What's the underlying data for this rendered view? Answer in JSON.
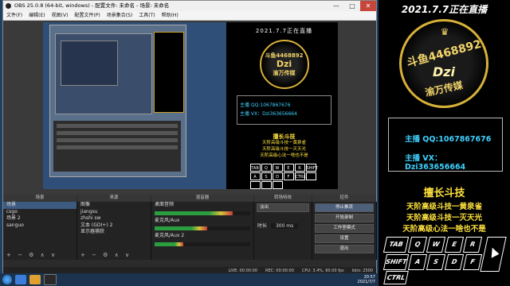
{
  "window": {
    "title": "OBS 25.0.8 (64-bit, windows) - 配置文件: 未命名 - 场景: 未命名",
    "buttons": {
      "minimize": "—",
      "maximize": "□",
      "close": "✕"
    },
    "menu": [
      "文件(F)",
      "编辑(E)",
      "视图(V)",
      "配置文件(P)",
      "场景集合(S)",
      "工具(T)",
      "帮助(H)"
    ]
  },
  "preview": {
    "date": "2021.7.7正在直播",
    "logo_line1": "斗鱼4468892",
    "logo_line2": "Dzi",
    "logo_line3": "渝万传媒",
    "host_qq": "主播 QQ:1067867676",
    "host_vx": "主播 VX：Dzi363656664",
    "skill_title": "擅长斗技",
    "skills": [
      "天阶高级斗技一黄泉雀",
      "天阶高级斗技一灭天光",
      "天阶高级心法一啥也不是"
    ],
    "keys": [
      "TAB",
      "Q",
      "W",
      "E",
      "R",
      "SHIFT",
      "A",
      "S",
      "D",
      "F",
      "CTRL",
      "",
      "",
      "",
      ""
    ]
  },
  "docks": {
    "scenes": {
      "header": "场景",
      "items": [
        "场景",
        "csgo",
        "场景 2",
        "sanguo"
      ],
      "selected": 0
    },
    "sources": {
      "header": "来源",
      "items": [
        "图像",
        "jiangsu",
        "zhshi sw",
        "文本 (GDI+) 2",
        "显示器捕获"
      ]
    },
    "mixer": {
      "header": "混音器",
      "channels": [
        {
          "name": "桌面音频",
          "level": 0.82
        },
        {
          "name": "麦克风/Aux",
          "level": 0.55
        },
        {
          "name": "麦克风/Aux 2",
          "level": 0.3
        }
      ]
    },
    "transitions": {
      "header": "转场特效",
      "type": "淡出",
      "duration_label": "时长",
      "duration": "300 ms"
    },
    "controls": {
      "header": "控件",
      "buttons": [
        "停止推流",
        "开始录制",
        "工作室模式",
        "设置",
        "退出"
      ]
    },
    "toolbar_symbols": "+ − ⚙ ∧ ∨"
  },
  "status": {
    "live": "LIVE: 00:00:00",
    "rec": "REC: 00:00:00",
    "cpu": "CPU: 3.4%, 60.00 fps",
    "bitrate": "kb/s: 2500"
  },
  "taskbar": {
    "time": "20:57",
    "date": "2021/7/7"
  },
  "overlay": {
    "date": "2021.7.7正在直播",
    "logo_crown": "♛",
    "logo_line1": "斗鱼4468892",
    "logo_line2": "Dzi",
    "logo_line3": "渝万传媒",
    "host_qq": "主播 QQ:1067867676",
    "host_vx": "主播 VX：Dzi363656664",
    "skill_title": "擅长斗技",
    "skills": [
      "天阶高级斗技一黄泉雀",
      "天阶高级斗技一灭天光",
      "天阶高级心法一啥也不是"
    ],
    "keys_row1": [
      "TAB",
      "Q",
      "W",
      "E",
      "R"
    ],
    "keys_row2": [
      "SHIFT",
      "A",
      "S",
      "D",
      "F"
    ],
    "keys_row3": [
      "CTRL",
      "",
      ""
    ]
  },
  "colors": {
    "accent_gold": "#d8b13a",
    "text_yellow": "#ffe23f",
    "text_cyan": "#3fd1ff"
  }
}
